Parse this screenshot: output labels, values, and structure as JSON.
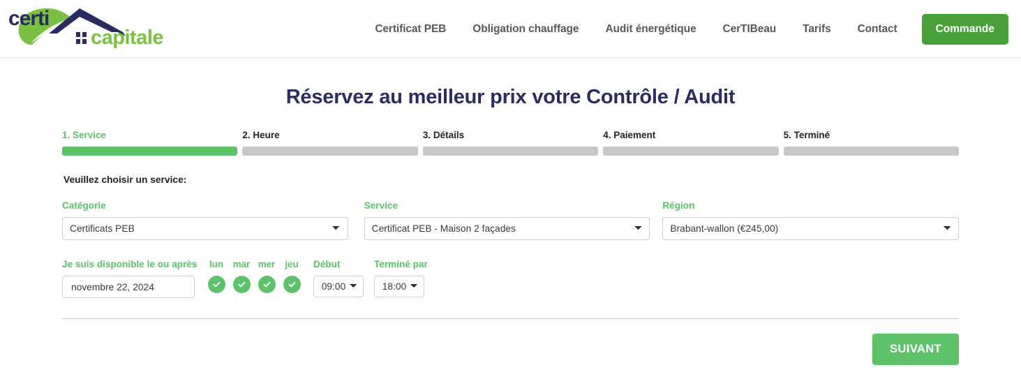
{
  "header": {
    "logo": {
      "text_primary": "certi",
      "text_secondary": "capitale",
      "primary_color": "#2b2c62",
      "secondary_color": "#7ac143"
    },
    "nav_items": [
      {
        "label": "Certificat PEB"
      },
      {
        "label": "Obligation chauffage"
      },
      {
        "label": "Audit énergétique"
      },
      {
        "label": "CerTIBeau"
      },
      {
        "label": "Tarifs"
      },
      {
        "label": "Contact"
      }
    ],
    "cta": {
      "label": "Commande",
      "color": "#49a03a"
    }
  },
  "page": {
    "title": "Réservez au meilleur prix votre Contrôle / Audit",
    "title_color": "#2b2c62"
  },
  "steps": {
    "active_index": 0,
    "active_color": "#5dc269",
    "inactive_color": "#c7c7c7",
    "items": [
      {
        "label": "1. Service"
      },
      {
        "label": "2. Heure"
      },
      {
        "label": "3. Détails"
      },
      {
        "label": "4. Paiement"
      },
      {
        "label": "5. Terminé"
      }
    ]
  },
  "form": {
    "instruction": "Veuillez choisir un service:",
    "category": {
      "label": "Catégorie",
      "value": "Certificats PEB",
      "options": [
        "Certificats PEB"
      ]
    },
    "service": {
      "label": "Service",
      "value": "Certificat PEB - Maison 2 façades",
      "options": [
        "Certificat PEB - Maison 2 façades"
      ]
    },
    "region": {
      "label": "Région",
      "value": "Brabant-wallon (€245,00)",
      "options": [
        "Brabant-wallon (€245,00)"
      ]
    },
    "availability": {
      "label": "Je suis disponible le ou après",
      "date_value": "novembre 22, 2024",
      "days": [
        {
          "name": "lun",
          "selected": true,
          "icon": "check-icon"
        },
        {
          "name": "mar",
          "selected": true,
          "icon": "check-icon"
        },
        {
          "name": "mer",
          "selected": true,
          "icon": "check-icon"
        },
        {
          "name": "jeu",
          "selected": true,
          "icon": "check-icon"
        }
      ],
      "start": {
        "label": "Début",
        "value": "09:00",
        "options": [
          "09:00"
        ]
      },
      "end": {
        "label": "Terminé par",
        "value": "18:00",
        "options": [
          "18:00"
        ]
      }
    }
  },
  "actions": {
    "next_label": "SUIVANT",
    "next_color": "#5dc269"
  }
}
